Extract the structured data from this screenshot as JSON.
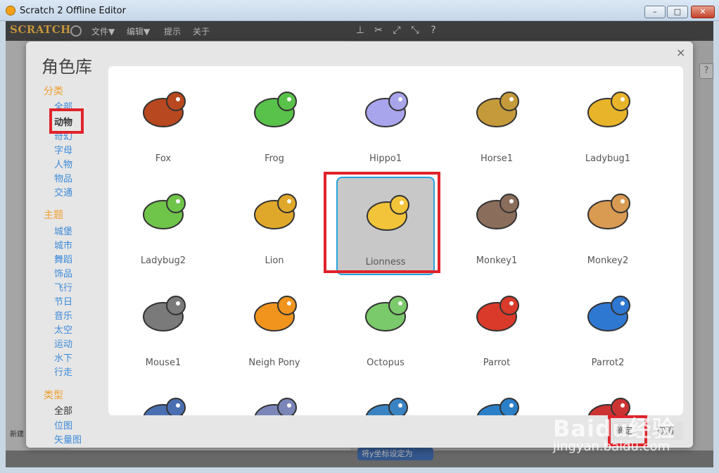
{
  "window": {
    "title": "Scratch 2 Offline Editor",
    "close_glyph": "✕",
    "min_glyph": "–",
    "max_glyph": "□"
  },
  "menubar": {
    "logo": "SCRATCH",
    "items": [
      "文件▼",
      "编辑▼",
      "提示",
      "关于"
    ]
  },
  "dialog": {
    "title": "角色库",
    "close": "×",
    "sidebar": {
      "category_header": "分类",
      "categories": [
        "全部",
        "动物",
        "奇幻",
        "字母",
        "人物",
        "物品",
        "交通"
      ],
      "selected_category": "动物",
      "theme_header": "主题",
      "themes": [
        "城堡",
        "城市",
        "舞蹈",
        "饰品",
        "飞行",
        "节日",
        "音乐",
        "太空",
        "运动",
        "水下",
        "行走"
      ],
      "type_header": "类型",
      "types": [
        "全部",
        "位图",
        "矢量图"
      ]
    },
    "sprites": [
      {
        "name": "Fox",
        "color": "#b8481f"
      },
      {
        "name": "Frog",
        "color": "#59c24a"
      },
      {
        "name": "Hippo1",
        "color": "#a9a5ec"
      },
      {
        "name": "Horse1",
        "color": "#c49a3b"
      },
      {
        "name": "Ladybug1",
        "color": "#e8b42a"
      },
      {
        "name": "Ladybug2",
        "color": "#6fc44a"
      },
      {
        "name": "Lion",
        "color": "#e0a82a"
      },
      {
        "name": "Lionness",
        "color": "#f2c43a"
      },
      {
        "name": "Monkey1",
        "color": "#8a6d5a"
      },
      {
        "name": "Monkey2",
        "color": "#d99a52"
      },
      {
        "name": "Mouse1",
        "color": "#7a7a7a"
      },
      {
        "name": "Neigh Pony",
        "color": "#f0941e"
      },
      {
        "name": "Octopus",
        "color": "#7ac96a"
      },
      {
        "name": "Parrot",
        "color": "#d93a2a"
      },
      {
        "name": "Parrot2",
        "color": "#2f78d1"
      },
      {
        "name": "",
        "color": "#4a6fb0"
      },
      {
        "name": "",
        "color": "#7a86b8"
      },
      {
        "name": "",
        "color": "#3a83c2"
      },
      {
        "name": "",
        "color": "#2a7fc7"
      },
      {
        "name": "",
        "color": "#c33"
      }
    ],
    "selected_sprite": "Lionness",
    "ok_label": "确定",
    "cancel_label": "取消"
  },
  "background": {
    "new_sprite_label": "新建",
    "block_label": "将y坐标设定为"
  },
  "watermark": {
    "brand": "Baidu经验",
    "url": "jingyan.baidu.com"
  }
}
